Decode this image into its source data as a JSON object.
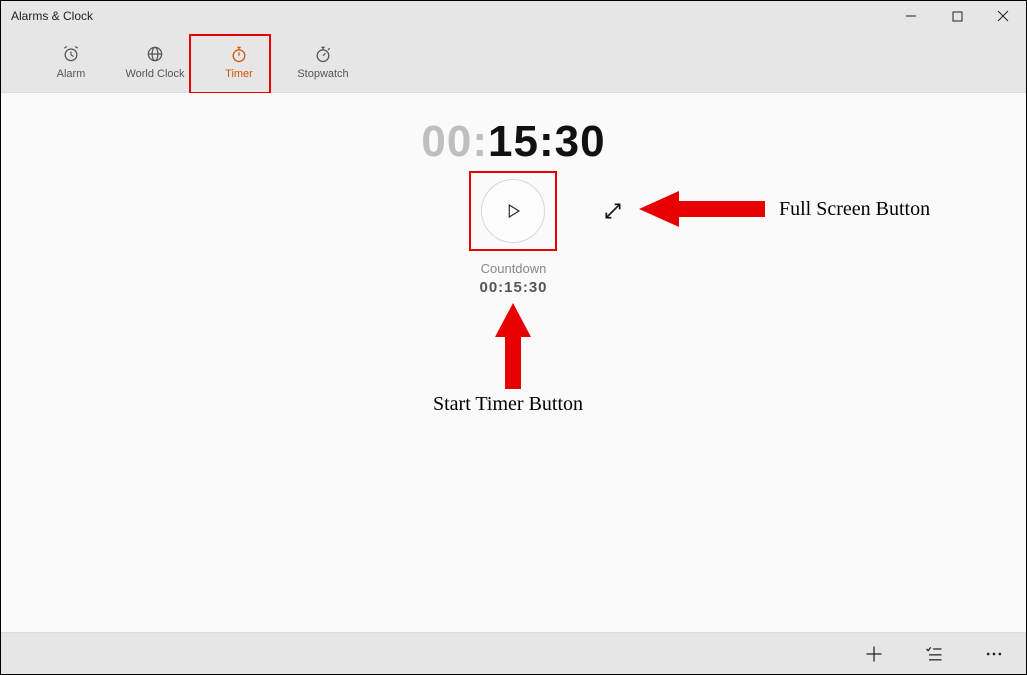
{
  "window": {
    "title": "Alarms & Clock"
  },
  "tabs": {
    "alarm": "Alarm",
    "world_clock": "World Clock",
    "timer": "Timer",
    "stopwatch": "Stopwatch",
    "active": "timer"
  },
  "timer": {
    "display_dim": "00",
    "display_sep1": ":",
    "display_mid": "15",
    "display_sep2": ":",
    "display_end": "30",
    "countdown_label": "Countdown",
    "countdown_value": "00:15:30"
  },
  "annotations": {
    "fullscreen_label": "Full Screen Button",
    "start_label": "Start Timer Button"
  },
  "colors": {
    "accent": "#d35400",
    "annotation_red": "#e60000"
  }
}
